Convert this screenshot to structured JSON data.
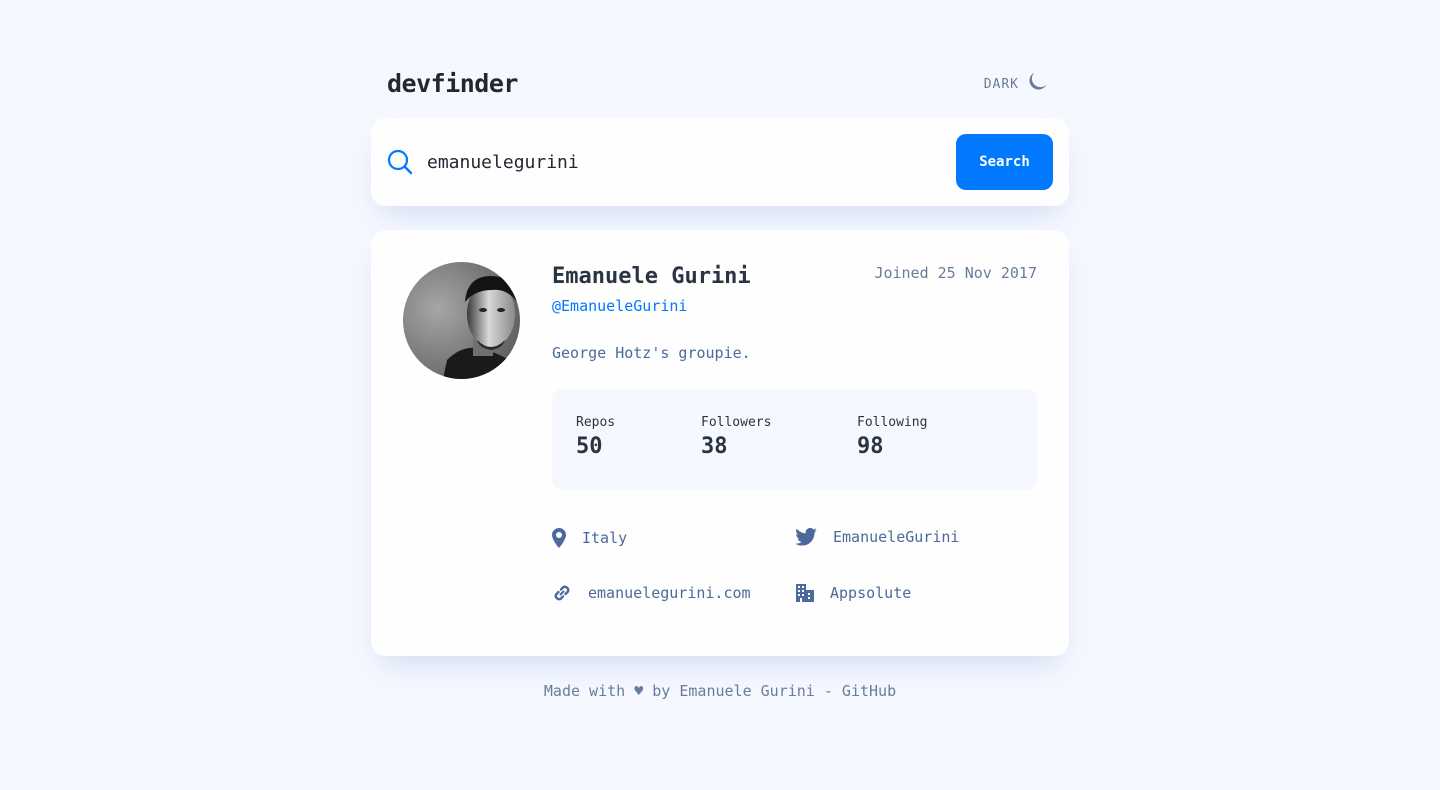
{
  "header": {
    "logo": "devfinder",
    "theme_label": "DARK"
  },
  "search": {
    "value": "emanuelegurini",
    "button_label": "Search"
  },
  "profile": {
    "name": "Emanuele Gurini",
    "handle": "@EmanueleGurini",
    "joined": "Joined 25 Nov 2017",
    "bio": "George Hotz's groupie.",
    "stats": [
      {
        "label": "Repos",
        "value": "50"
      },
      {
        "label": "Followers",
        "value": "38"
      },
      {
        "label": "Following",
        "value": "98"
      }
    ],
    "links": {
      "location": "Italy",
      "twitter": "EmanueleGurini",
      "website": "emanuelegurini.com",
      "company": "Appsolute"
    }
  },
  "footer": {
    "prefix": "Made with",
    "heart": "♥",
    "by": "by Emanuele Gurini -",
    "link": "GitHub"
  },
  "colors": {
    "background": "#f5f8ff",
    "accent": "#0079ff",
    "card": "#fefefe",
    "text_muted": "#697c9a",
    "text_secondary": "#4b6a9b"
  }
}
